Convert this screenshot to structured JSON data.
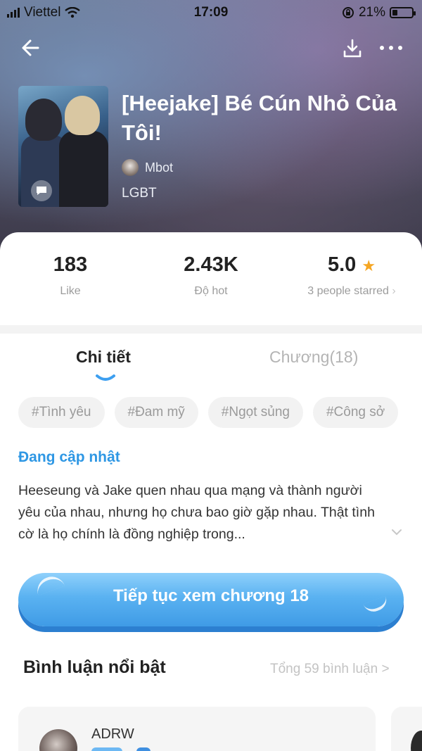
{
  "status_bar": {
    "carrier": "Viettel",
    "time": "17:09",
    "battery": "21%"
  },
  "book": {
    "title": "[Heejake] Bé Cún Nhỏ Của Tôi!",
    "author": "Mbot",
    "genre": "LGBT"
  },
  "stats": [
    {
      "value": "183",
      "label": "Like"
    },
    {
      "value": "2.43K",
      "label": "Độ hot"
    },
    {
      "value": "5.0",
      "label": "3 people starred"
    }
  ],
  "tabs": [
    {
      "label": "Chi tiết"
    },
    {
      "label": "Chương(18)"
    }
  ],
  "tags": [
    "#Tình yêu",
    "#Đam mỹ",
    "#Ngọt sủng",
    "#Công sở"
  ],
  "update_status": "Đang cập nhật",
  "description": "Heeseung và Jake quen nhau qua mạng và thành người yêu của nhau, nhưng họ chưa bao giờ gặp nhau. Thật tình cờ là họ chính là đồng nghiệp trong...",
  "cta_label": "Tiếp tục xem chương 18",
  "comments": {
    "heading": "Bình luận nổi bật",
    "total_link": "Tổng 59 bình luận >",
    "items": [
      {
        "author": "ADRW"
      }
    ]
  },
  "colors": {
    "accent": "#2e97e4",
    "star": "#f5a623",
    "cta": "#4aa6ec"
  }
}
